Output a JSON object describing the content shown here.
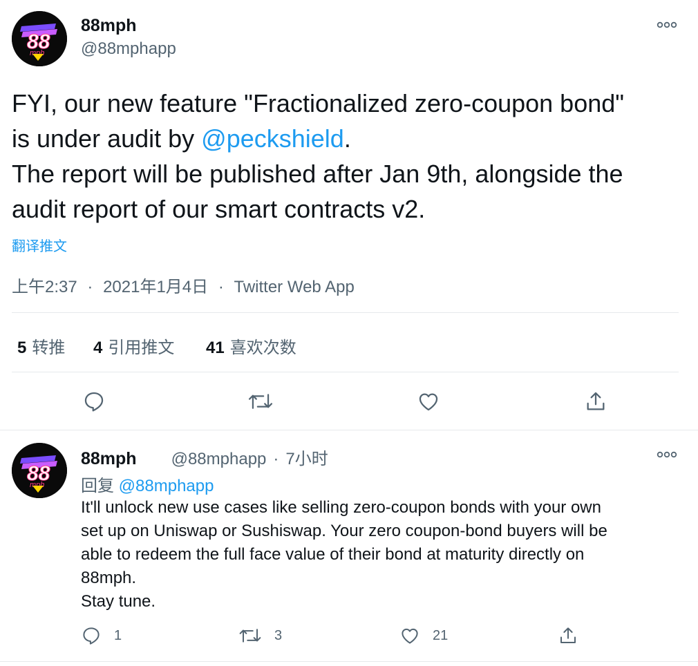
{
  "main_tweet": {
    "name": "88mph",
    "handle": "@88mphapp",
    "text_before_link": "FYI, our new feature \"Fractionalized zero-coupon bond\"\nis under audit by ",
    "mention": "@peckshield",
    "text_after_link": ".\nThe report will be published after Jan 9th, alongside the\naudit report of our smart contracts v2.",
    "translate_label": "翻译推文",
    "time": "上午2:37",
    "date": "2021年1月4日",
    "source": "Twitter Web App",
    "separator": "·",
    "stats": {
      "retweets_count": "5",
      "retweets_label": "转推",
      "quotes_count": "4",
      "quotes_label": "引用推文",
      "likes_count": "41",
      "likes_label": "喜欢次数"
    }
  },
  "reply_tweet": {
    "name": "88mph",
    "handle": "@88mphapp",
    "separator": "·",
    "time": "7小时",
    "reply_to_label": "回复",
    "reply_to_handle": "@88mphapp",
    "text": "It'll unlock new use cases like selling zero-coupon bonds with your own\nset up on Uniswap or Sushiswap. Your zero coupon-bond buyers will be\nable to redeem the full face value of their bond at maturity directly on\n88mph.\nStay tune.",
    "reply_count": "1",
    "retweet_count": "3",
    "like_count": "21"
  },
  "colors": {
    "accent": "#1d9bf0",
    "secondary_text": "#536471",
    "divider": "#e6e9eb"
  },
  "icons": [
    "logo-avatar",
    "more-icon",
    "reply-icon",
    "retweet-icon",
    "like-icon",
    "share-icon"
  ]
}
